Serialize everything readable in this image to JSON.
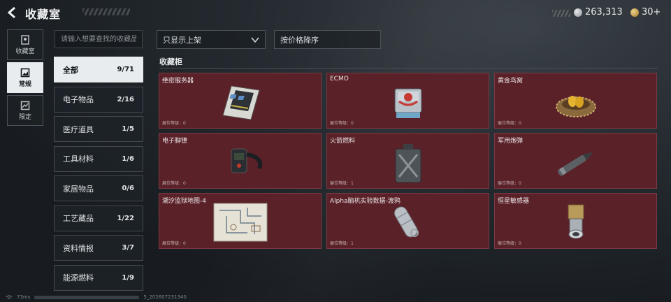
{
  "header": {
    "title": "收藏室"
  },
  "currency": [
    {
      "icon": "silver-coin-icon",
      "value": "263,313",
      "color": "#b8bcc0"
    },
    {
      "icon": "gold-coin-icon",
      "value": "30+",
      "color": "#c9a24a"
    }
  ],
  "nav": [
    {
      "label": "收藏室",
      "icon": "collection-room-icon",
      "active": false
    },
    {
      "label": "常规",
      "icon": "regular-image-icon",
      "active": true
    },
    {
      "label": "限定",
      "icon": "limited-image-icon",
      "active": false
    }
  ],
  "search": {
    "placeholder": "请输入想要查找的收藏品"
  },
  "filters": {
    "shelf": "只显示上架",
    "sort": "按价格降序"
  },
  "categories": [
    {
      "label": "全部",
      "count": "9/71",
      "active": true
    },
    {
      "label": "电子物品",
      "count": "2/16"
    },
    {
      "label": "医疗道具",
      "count": "1/5"
    },
    {
      "label": "工具材料",
      "count": "1/6"
    },
    {
      "label": "家居物品",
      "count": "0/6"
    },
    {
      "label": "工艺藏品",
      "count": "1/22"
    },
    {
      "label": "资料情报",
      "count": "3/7"
    },
    {
      "label": "能源燃料",
      "count": "1/9"
    }
  ],
  "section": {
    "title": "收藏柜"
  },
  "items": [
    {
      "name": "绝密服务器",
      "level": "展位等级：0",
      "icon": "server-icon"
    },
    {
      "name": "ECMO",
      "level": "展位等级：0",
      "icon": "ecmo-machine-icon"
    },
    {
      "name": "黄金鸟窝",
      "level": "展位等级：0",
      "icon": "golden-nest-icon"
    },
    {
      "name": "电子脚镣",
      "level": "展位等级：0",
      "icon": "ankle-monitor-icon"
    },
    {
      "name": "火箭燃料",
      "level": "展位等级：1",
      "icon": "fuel-canister-icon"
    },
    {
      "name": "军用炮弹",
      "level": "展位等级：0",
      "icon": "artillery-shell-icon"
    },
    {
      "name": "潮汐监狱地图-4",
      "level": "展位等级：0",
      "icon": "prison-map-icon"
    },
    {
      "name": "Alpha脑机实验数据-渡鸦",
      "level": "展位等级：1",
      "icon": "data-drive-icon"
    },
    {
      "name": "恒星敏感器",
      "level": "展位等级：0",
      "icon": "star-sensor-icon"
    }
  ],
  "status": {
    "latency": "73ms",
    "build": "5_202607231340"
  }
}
